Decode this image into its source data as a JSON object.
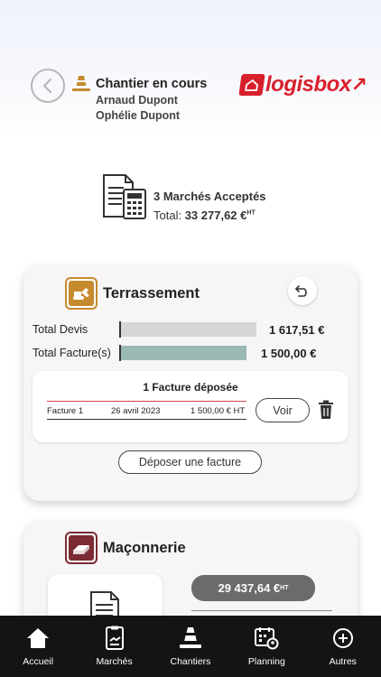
{
  "header": {
    "title": "Chantier en cours",
    "owners": [
      "Arnaud Dupont",
      "Ophélie Dupont"
    ],
    "logo_text": "logisbox"
  },
  "summary": {
    "title": "3 Marchés Acceptés",
    "total_label": "Total:",
    "total_value": "33 277,62 €",
    "total_suffix": "HT"
  },
  "cards": [
    {
      "title": "Terrassement",
      "total_devis_label": "Total Devis",
      "total_devis_value": "1 617,51 €",
      "total_devis_fraction": 1.0,
      "total_factures_label": "Total Facture(s)",
      "total_factures_value": "1 500,00 €",
      "total_factures_fraction": 0.927,
      "invoices_heading": "1 Facture déposée",
      "invoice": {
        "name": "Facture 1",
        "date": "26 avril 2023",
        "amount": "1 500,00 € HT"
      },
      "voir_label": "Voir",
      "deposit_label": "Déposer une facture"
    },
    {
      "title": "Maçonnerie",
      "amount": "29 437,64 €",
      "amount_suffix": "HT"
    }
  ],
  "nav": [
    {
      "label": "Accueil",
      "icon": "home-icon"
    },
    {
      "label": "Marchés",
      "icon": "contract-icon"
    },
    {
      "label": "Chantiers",
      "icon": "cone-icon"
    },
    {
      "label": "Planning",
      "icon": "calendar-icon"
    },
    {
      "label": "Autres",
      "icon": "plus-circle-icon"
    }
  ],
  "colors": {
    "brand": "#d8202c",
    "terrassement": "#c58a2e",
    "maconnerie": "#7a2b33",
    "devis_bar": "#d6d6d6",
    "facture_bar": "#9ab9b4",
    "nav_bg": "#141414"
  }
}
